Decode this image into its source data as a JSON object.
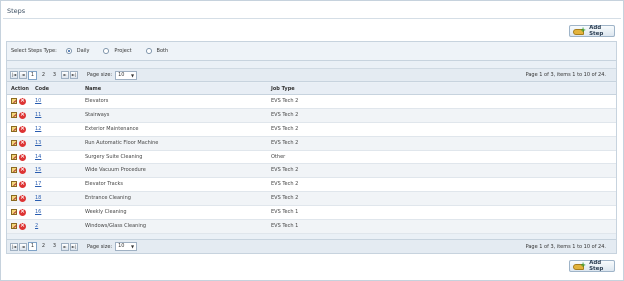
{
  "page": {
    "title": "Steps"
  },
  "toolbar": {
    "add_label": "Add Step"
  },
  "filter": {
    "label": "Select Steps Type:",
    "options": [
      {
        "label": "Daily",
        "selected": true
      },
      {
        "label": "Project",
        "selected": false
      },
      {
        "label": "Both",
        "selected": false
      }
    ]
  },
  "pager": {
    "first": "|◄",
    "prev": "◄",
    "next": "►",
    "last": "►|",
    "pages": [
      "1",
      "2",
      "3"
    ],
    "current_page": "1",
    "page_size_label": "Page size:",
    "page_size": "10",
    "info": "Page 1 of 3, items 1 to 10 of 24."
  },
  "table": {
    "columns": [
      "Action",
      "Code",
      "Name",
      "Job Type"
    ],
    "rows": [
      {
        "code": "10",
        "name": "Elevators",
        "job_type": "EVS Tech 2"
      },
      {
        "code": "11",
        "name": "Stairways",
        "job_type": "EVS Tech 2"
      },
      {
        "code": "12",
        "name": "Exterior Maintenance",
        "job_type": "EVS Tech 2"
      },
      {
        "code": "13",
        "name": "Run Automatic Floor Machine",
        "job_type": "EVS Tech 2"
      },
      {
        "code": "14",
        "name": "Surgery Suite Cleaning",
        "job_type": "Other"
      },
      {
        "code": "15",
        "name": "Wide Vacuum Procedure",
        "job_type": "EVS Tech 2"
      },
      {
        "code": "17",
        "name": "Elevator Tracks",
        "job_type": "EVS Tech 2"
      },
      {
        "code": "18",
        "name": "Entrance Cleaning",
        "job_type": "EVS Tech 2"
      },
      {
        "code": "16",
        "name": "Weekly Cleaning",
        "job_type": "EVS Tech 1"
      },
      {
        "code": "2",
        "name": "Windows/Glass Cleaning",
        "job_type": "EVS Tech 1"
      }
    ]
  },
  "icons": {
    "edit": "edit-icon",
    "delete": "delete-icon",
    "add": "add-step-icon"
  }
}
